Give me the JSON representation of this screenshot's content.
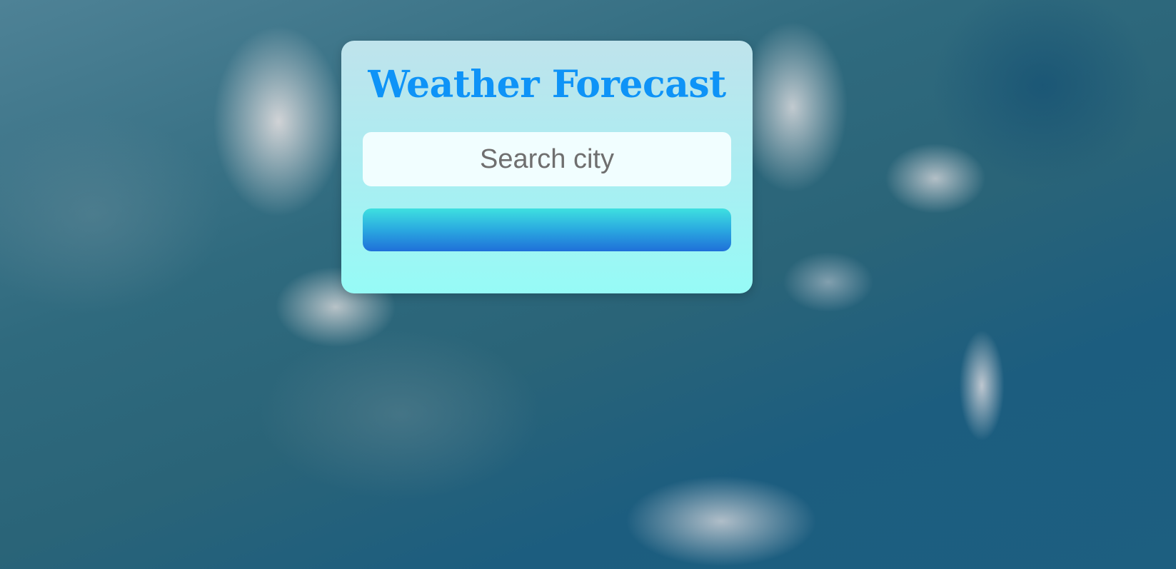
{
  "app": {
    "title": "Weather Forecast"
  },
  "search": {
    "placeholder": "Search city",
    "value": ""
  },
  "search_button": {
    "label": ""
  },
  "colors": {
    "title": "#0e93f7",
    "card_top": "#bfe3ec",
    "card_bottom": "#96fbf6",
    "button_top": "#3ee0e0",
    "button_bottom": "#1f6fd9"
  }
}
